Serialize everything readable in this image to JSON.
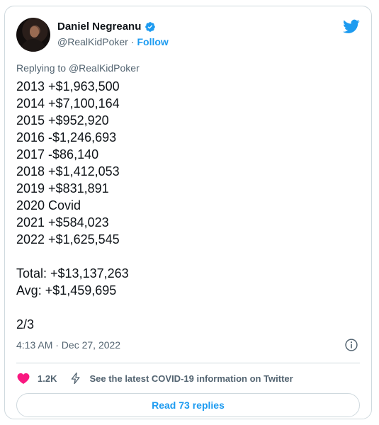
{
  "tweet": {
    "author_name": "Daniel Negreanu",
    "handle": "@RealKidPoker",
    "separator": "·",
    "follow_label": "Follow",
    "replying_to_prefix": "Replying to",
    "replying_to_handle": "@RealKidPoker",
    "lines": [
      "2013 +$1,963,500",
      "2014 +$7,100,164",
      "2015 +$952,920",
      "2016 -$1,246,693",
      "2017 -$86,140",
      "2018 +$1,412,053",
      "2019 +$831,891",
      "2020 Covid",
      "2021 +$584,023",
      "2022 +$1,625,545",
      "",
      "Total: +$13,137,263",
      "Avg: +$1,459,695",
      "",
      "2/3"
    ],
    "timestamp": "4:13 AM · Dec 27, 2022"
  },
  "actions": {
    "like_count": "1.2K",
    "covid_link": "See the latest COVID-19 information on Twitter",
    "replies_button": "Read 73 replies"
  },
  "icons": {
    "verified": "verified-badge-icon",
    "brand": "twitter-bird-icon",
    "info": "info-icon",
    "like": "heart-icon",
    "covid": "flash-icon"
  },
  "colors": {
    "accent": "#1d9bf0",
    "like": "#f91880",
    "text": "#0f1419",
    "muted": "#536471",
    "border": "#cfd9de"
  }
}
